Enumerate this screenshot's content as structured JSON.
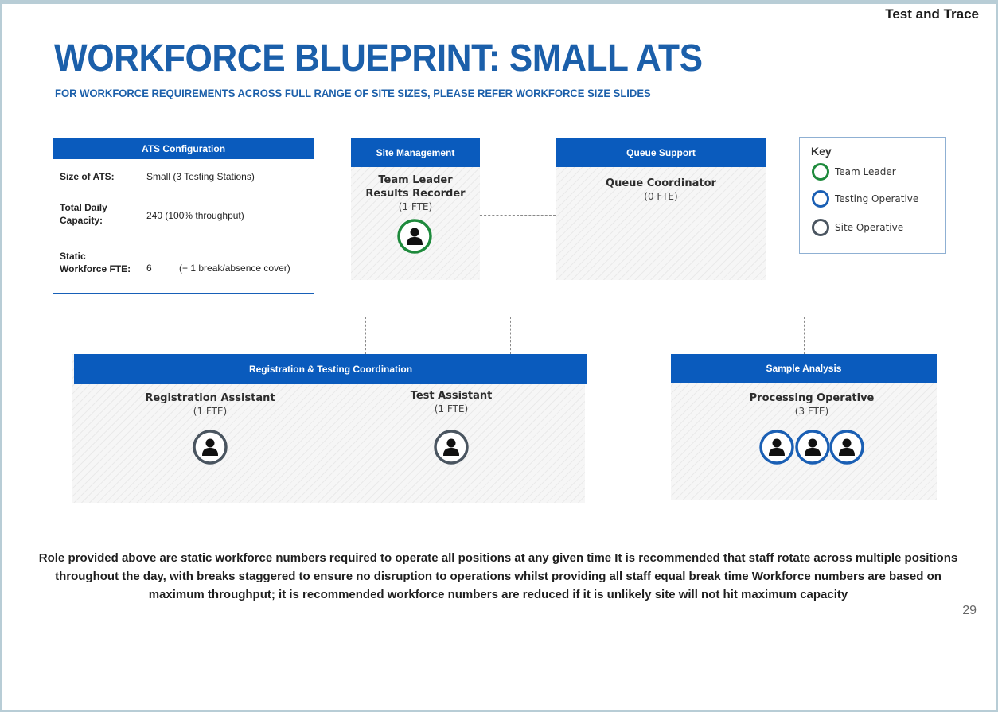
{
  "header": {
    "brand": "Test and Trace",
    "title": "WORKFORCE BLUEPRINT: SMALL ATS",
    "subtitle": "FOR WORKFORCE REQUIREMENTS ACROSS FULL RANGE OF SITE SIZES, PLEASE REFER WORKFORCE SIZE SLIDES"
  },
  "ats_config": {
    "heading": "ATS Configuration",
    "size_label": "Size of ATS:",
    "size_value": "Small (3 Testing Stations)",
    "capacity_label_1": "Total Daily",
    "capacity_label_2": "Capacity:",
    "capacity_value": "240 (100% throughput)",
    "fte_label_1": "Static",
    "fte_label_2": "Workforce FTE:",
    "fte_value": "6",
    "fte_note": "(+ 1 break/absence cover)"
  },
  "site_management": {
    "heading": "Site Management",
    "role_line_1": "Team Leader",
    "role_line_2": "Results Recorder",
    "fte": "(1 FTE)",
    "role_type": "team-leader"
  },
  "queue_support": {
    "heading": "Queue Support",
    "role": "Queue Coordinator",
    "fte": "(0 FTE)"
  },
  "key": {
    "title": "Key",
    "items": [
      {
        "label": "Team Leader",
        "color": "#1e8a3c"
      },
      {
        "label": "Testing Operative",
        "color": "#1a5fb4"
      },
      {
        "label": "Site Operative",
        "color": "#4a5560"
      }
    ]
  },
  "registration": {
    "heading": "Registration & Testing Coordination",
    "roles": [
      {
        "name": "Registration Assistant",
        "fte": "(1 FTE)",
        "role_type": "site-operative"
      },
      {
        "name": "Test Assistant",
        "fte": "(1 FTE)",
        "role_type": "site-operative"
      }
    ]
  },
  "sample_analysis": {
    "heading": "Sample Analysis",
    "role": "Processing Operative",
    "fte": "(3 FTE)",
    "role_type": "testing-operative",
    "count": 3
  },
  "colors": {
    "header_blue": "#0a5bbd",
    "title_blue": "#1b5faa",
    "team_leader": "#1e8a3c",
    "testing_operative": "#1a5fb4",
    "site_operative": "#4a5560"
  },
  "footnote": "Role provided above are static workforce numbers required to operate all positions at any given time It is recommended that staff rotate across multiple positions throughout the day, with breaks staggered to ensure no disruption to operations whilst providing all staff equal break time Workforce numbers are based on maximum throughput; it is recommended workforce numbers are reduced if it is unlikely site will not hit maximum capacity",
  "page_number": "29"
}
